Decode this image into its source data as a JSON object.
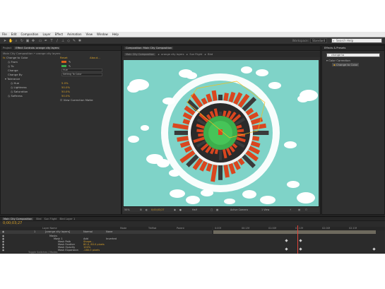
{
  "menu": [
    "File",
    "Edit",
    "Composition",
    "Layer",
    "Effect",
    "Animation",
    "View",
    "Window",
    "Help"
  ],
  "toolbar": {
    "workspace_label": "Workspace:",
    "workspace_value": "Standard",
    "search_placeholder": "Search Help"
  },
  "effects_panel": {
    "tabs": [
      "Project",
      "Effect Controls: orange city layers"
    ],
    "header": "Main City Composition • orange city layers",
    "effect_name": "Change to Color",
    "reset_label": "Reset",
    "about_label": "About...",
    "rows": [
      {
        "label": "From",
        "value": ""
      },
      {
        "label": "To",
        "value": ""
      },
      {
        "label": "Change",
        "value": "Hue"
      },
      {
        "label": "Change By",
        "value": "Setting To Color"
      },
      {
        "label": "Tolerance",
        "value": ""
      },
      {
        "label": "Hue",
        "value": "5.0%"
      },
      {
        "label": "Lightness",
        "value": "50.0%"
      },
      {
        "label": "Saturation",
        "value": "50.0%"
      },
      {
        "label": "Softness",
        "value": "50.0%"
      },
      {
        "label": "View Correction Matte",
        "value": ""
      }
    ],
    "from_color": "#d9601a",
    "to_color": "#3cae4c"
  },
  "composition_panel": {
    "tabs": [
      "Composition: Main City Composition"
    ],
    "breadcrumbs": [
      "Main City Composition",
      "orange city layers",
      "Sun Flight",
      "Bird"
    ]
  },
  "viewer_bar": {
    "zoom": "50%",
    "timecode": "0;00;03;27",
    "resolution": "Half",
    "camera": "Active Camera",
    "views": "1 View"
  },
  "effects_presets_panel": {
    "tabs": [
      "Effects & Presets"
    ],
    "search_value": "change to",
    "category": "Color Correction",
    "result": "Change to Color"
  },
  "timeline": {
    "tabs": [
      "Main City Composition",
      "Bird",
      "Sun Flight",
      "Bird Layer 1"
    ],
    "timecode": "0;00;03;27",
    "columns": [
      "Layer Name",
      "Mode",
      "TrkMat",
      "Parent"
    ],
    "layers": [
      {
        "num": "1",
        "name": "[orange city layers]",
        "mode": "Normal",
        "parent": "None"
      },
      {
        "num": "",
        "name": "Masks",
        "mode": "",
        "parent": ""
      },
      {
        "num": "",
        "name": "Mask 1",
        "mode": "Add",
        "parent": "Inverted"
      },
      {
        "num": "",
        "name": "Mask Path",
        "mode": "Shape...",
        "parent": ""
      },
      {
        "num": "",
        "name": "Mask Feather",
        "mode": "80.0, 80.0 pixels",
        "parent": ""
      },
      {
        "num": "",
        "name": "Mask Opacity",
        "mode": "100%",
        "parent": ""
      },
      {
        "num": "",
        "name": "Mask Expansion",
        "mode": "-180.0 pixels",
        "parent": ""
      },
      {
        "num": "",
        "name": "Effects",
        "mode": "",
        "parent": ""
      }
    ],
    "ruler": [
      "0:00f",
      "00:15f",
      "01:00f",
      "01:15f",
      "02:00f",
      "02:15f"
    ],
    "toggle_label": "Toggle Switches / Modes"
  },
  "colors": {
    "accent": "#d6a02a",
    "canvas_bg": "#7fd3c8",
    "building": "#d9461f",
    "center": "#3cae4c"
  }
}
